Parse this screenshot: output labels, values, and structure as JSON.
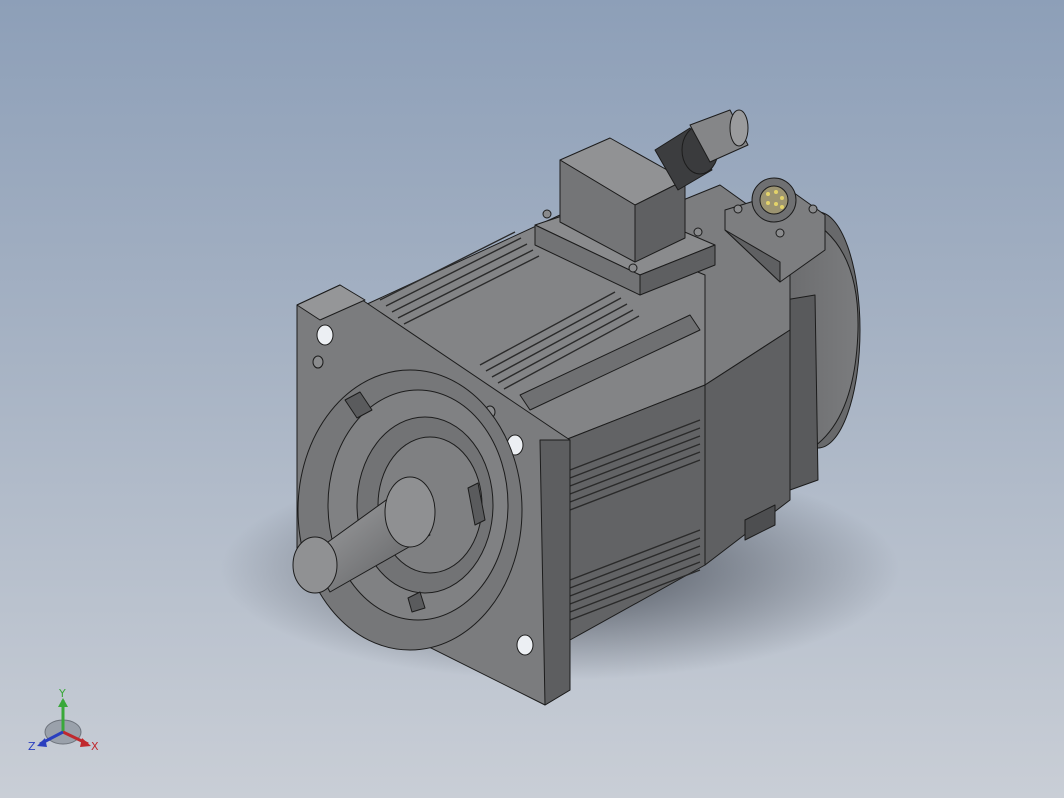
{
  "viewport": {
    "background_top": "#8d9fb8",
    "background_bottom": "#c9ced6",
    "model_name": "servo-motor-icon",
    "body_color": "#6d6e70",
    "edge_color": "#1c1c1c"
  },
  "triad": {
    "x_label": "X",
    "y_label": "Y",
    "z_label": "Z",
    "x_color": "#c0282d",
    "y_color": "#3aa83a",
    "z_color": "#2a3fbf"
  }
}
